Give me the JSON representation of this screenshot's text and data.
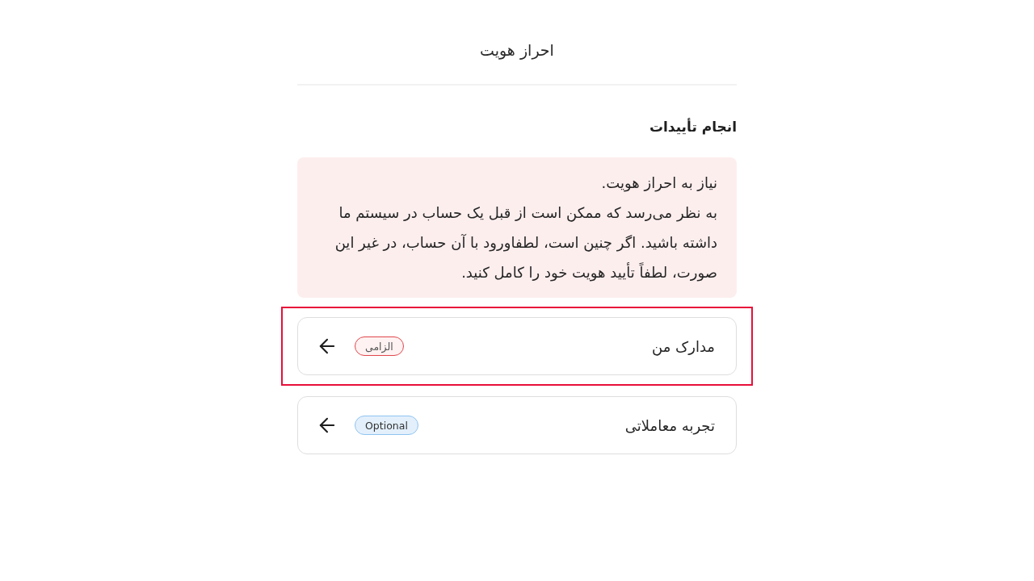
{
  "header": {
    "title": "احراز هویت"
  },
  "section": {
    "title": "انجام تأییدات"
  },
  "notice": {
    "title": "نیاز به احراز هویت.",
    "body": "به نظر می‌رسد که ممکن است از قبل یک حساب در سیستم ما داشته باشید. اگر چنین است، لطفاورود با آن حساب، در غیر این صورت، لطفاً تأیید هویت خود را کامل کنید."
  },
  "items": [
    {
      "label": "مدارک من",
      "badge": {
        "label": "الزامی",
        "kind": "required"
      },
      "highlighted": true
    },
    {
      "label": "تجربه معاملاتی",
      "badge": {
        "label": "Optional",
        "kind": "optional"
      },
      "highlighted": false
    }
  ]
}
